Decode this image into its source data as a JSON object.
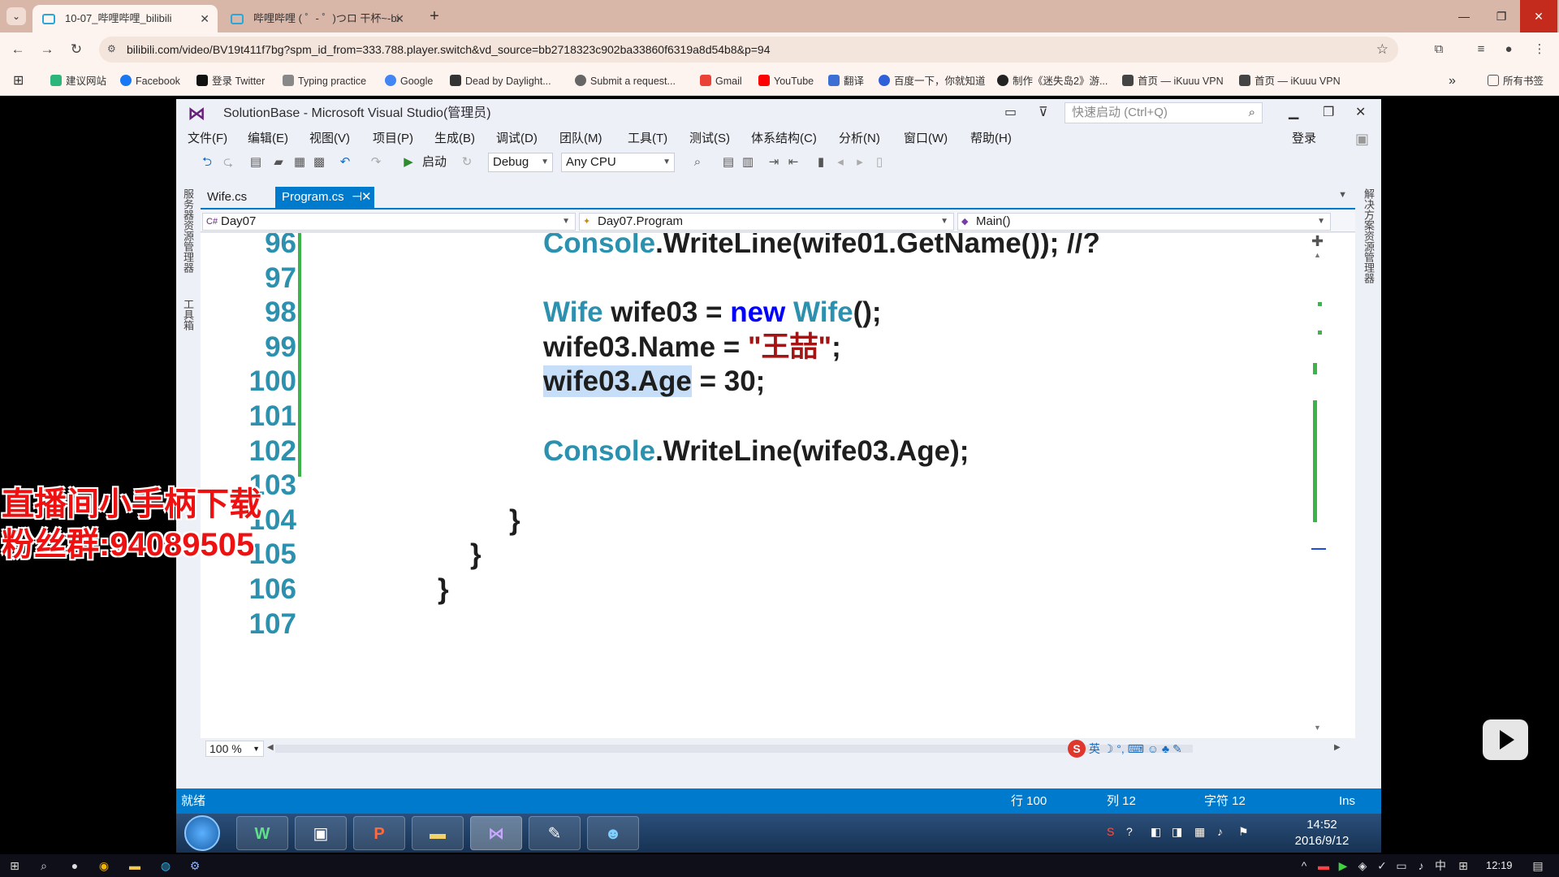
{
  "browser": {
    "tabs": [
      {
        "title": "10-07_哔哩哔哩_bilibili",
        "active": true
      },
      {
        "title": "哔哩哔哩 ( ゜- ゜)つロ 干杯~-bi",
        "active": false
      }
    ],
    "url": "bilibili.com/video/BV19t411f7bg?spm_id_from=333.788.player.switch&vd_source=bb2718323c902ba33860f6319a8d54b8&p=94",
    "bookmarks": [
      "建议网站",
      "Facebook",
      "登录 Twitter",
      "Typing practice",
      "Google",
      "Dead by Daylight...",
      "Submit a request...",
      "Gmail",
      "YouTube",
      "翻译",
      "百度一下，你就知道",
      "制作《迷失岛2》游...",
      "首页 — iKuuu VPN",
      "首页 — iKuuu VPN"
    ],
    "all_bookmarks": "所有书签"
  },
  "vs": {
    "title": "SolutionBase - Microsoft Visual Studio(管理员)",
    "quick_launch_placeholder": "快速启动 (Ctrl+Q)",
    "login": "登录",
    "menu": [
      "文件(F)",
      "编辑(E)",
      "视图(V)",
      "项目(P)",
      "生成(B)",
      "调试(D)",
      "团队(M)",
      "工具(T)",
      "测试(S)",
      "体系结构(C)",
      "分析(N)",
      "窗口(W)",
      "帮助(H)"
    ],
    "toolbar": {
      "start": "启动",
      "config": "Debug",
      "platform": "Any CPU"
    },
    "left_rail": [
      "服务器资源管理器",
      "工具箱"
    ],
    "right_rail": "解决方案资源管理器",
    "doc_tabs": [
      {
        "name": "Wife.cs",
        "active": false
      },
      {
        "name": "Program.cs",
        "active": true,
        "pin": "⊣",
        "close": "✕"
      }
    ],
    "nav": {
      "project": "Day07",
      "class": "Day07.Program",
      "member": "Main()"
    },
    "code_lines": [
      {
        "num": "96",
        "segments": [
          {
            "t": "Console",
            "c": "ty"
          },
          {
            "t": ".WriteLine(wife01.GetName()); //?",
            "c": ""
          }
        ]
      },
      {
        "num": "97",
        "segments": []
      },
      {
        "num": "98",
        "segments": [
          {
            "t": "Wife",
            "c": "ty"
          },
          {
            "t": " wife03 = ",
            "c": ""
          },
          {
            "t": "new",
            "c": "kw"
          },
          {
            "t": " ",
            "c": ""
          },
          {
            "t": "Wife",
            "c": "ty"
          },
          {
            "t": "();",
            "c": ""
          }
        ]
      },
      {
        "num": "99",
        "segments": [
          {
            "t": "wife03.Name = ",
            "c": ""
          },
          {
            "t": "\"王喆\"",
            "c": "st"
          },
          {
            "t": ";",
            "c": ""
          }
        ]
      },
      {
        "num": "100",
        "segments": [
          {
            "t": "wife03.Age",
            "c": "sel"
          },
          {
            "t": " = 30;",
            "c": ""
          }
        ]
      },
      {
        "num": "101",
        "segments": []
      },
      {
        "num": "102",
        "segments": [
          {
            "t": "Console",
            "c": "ty"
          },
          {
            "t": ".WriteLine(wife03.Age);",
            "c": ""
          }
        ]
      },
      {
        "num": "103",
        "segments": []
      },
      {
        "num": "104",
        "segments": [
          {
            "t": "}",
            "c": ""
          }
        ]
      },
      {
        "num": "105",
        "segments": [
          {
            "t": "}",
            "c": ""
          }
        ]
      },
      {
        "num": "106",
        "segments": [
          {
            "t": "}",
            "c": ""
          }
        ]
      },
      {
        "num": "107",
        "segments": []
      }
    ],
    "zoom": "100 %",
    "ime": "英",
    "status": {
      "ready": "就绪",
      "line": "行 100",
      "col": "列 12",
      "char": "字符 12",
      "mode": "Ins"
    }
  },
  "win7": {
    "time": "14:52",
    "date": "2016/9/12"
  },
  "overlay": {
    "line1": "直播间小手柄下载",
    "line2": "粉丝群:94089505"
  },
  "taskbar": {
    "time": "12:19",
    "ime": "中"
  }
}
